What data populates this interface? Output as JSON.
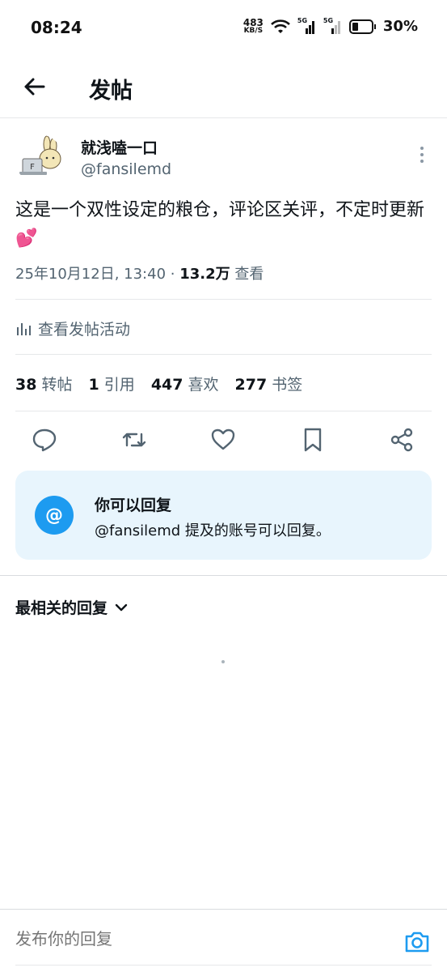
{
  "status_bar": {
    "time": "08:24",
    "net_speed_value": "483",
    "net_speed_unit": "KB/S",
    "signal1_label": "5G",
    "signal2_label": "5G",
    "battery": "30%"
  },
  "header": {
    "title": "发帖",
    "back_icon": "arrow-left-icon"
  },
  "post": {
    "display_name": "就浅嗑一口",
    "handle": "@fansilemd",
    "text": "这是一个双性设定的粮仓，评论区关评，不定时更新💕",
    "date": "25年10月12日, 13:40 · ",
    "views_count": "13.2万",
    "views_label": " 查看"
  },
  "activity": {
    "label": "查看发帖活动",
    "icon": "bar-chart-icon"
  },
  "stats": [
    {
      "num": "38",
      "label": "转帖"
    },
    {
      "num": "1",
      "label": "引用"
    },
    {
      "num": "447",
      "label": "喜欢"
    },
    {
      "num": "277",
      "label": "书签"
    }
  ],
  "actions": [
    "reply-icon",
    "repost-icon",
    "like-icon",
    "bookmark-icon",
    "share-icon"
  ],
  "reply_card": {
    "badge": "@",
    "title": "你可以回复",
    "desc": "@fansilemd 提及的账号可以回复。"
  },
  "replies": {
    "sort_label": "最相关的回复"
  },
  "compose": {
    "placeholder": "发布你的回复"
  },
  "colors": {
    "accent": "#1d9bf0",
    "card_bg": "#e8f5fd",
    "muted": "#536471"
  }
}
